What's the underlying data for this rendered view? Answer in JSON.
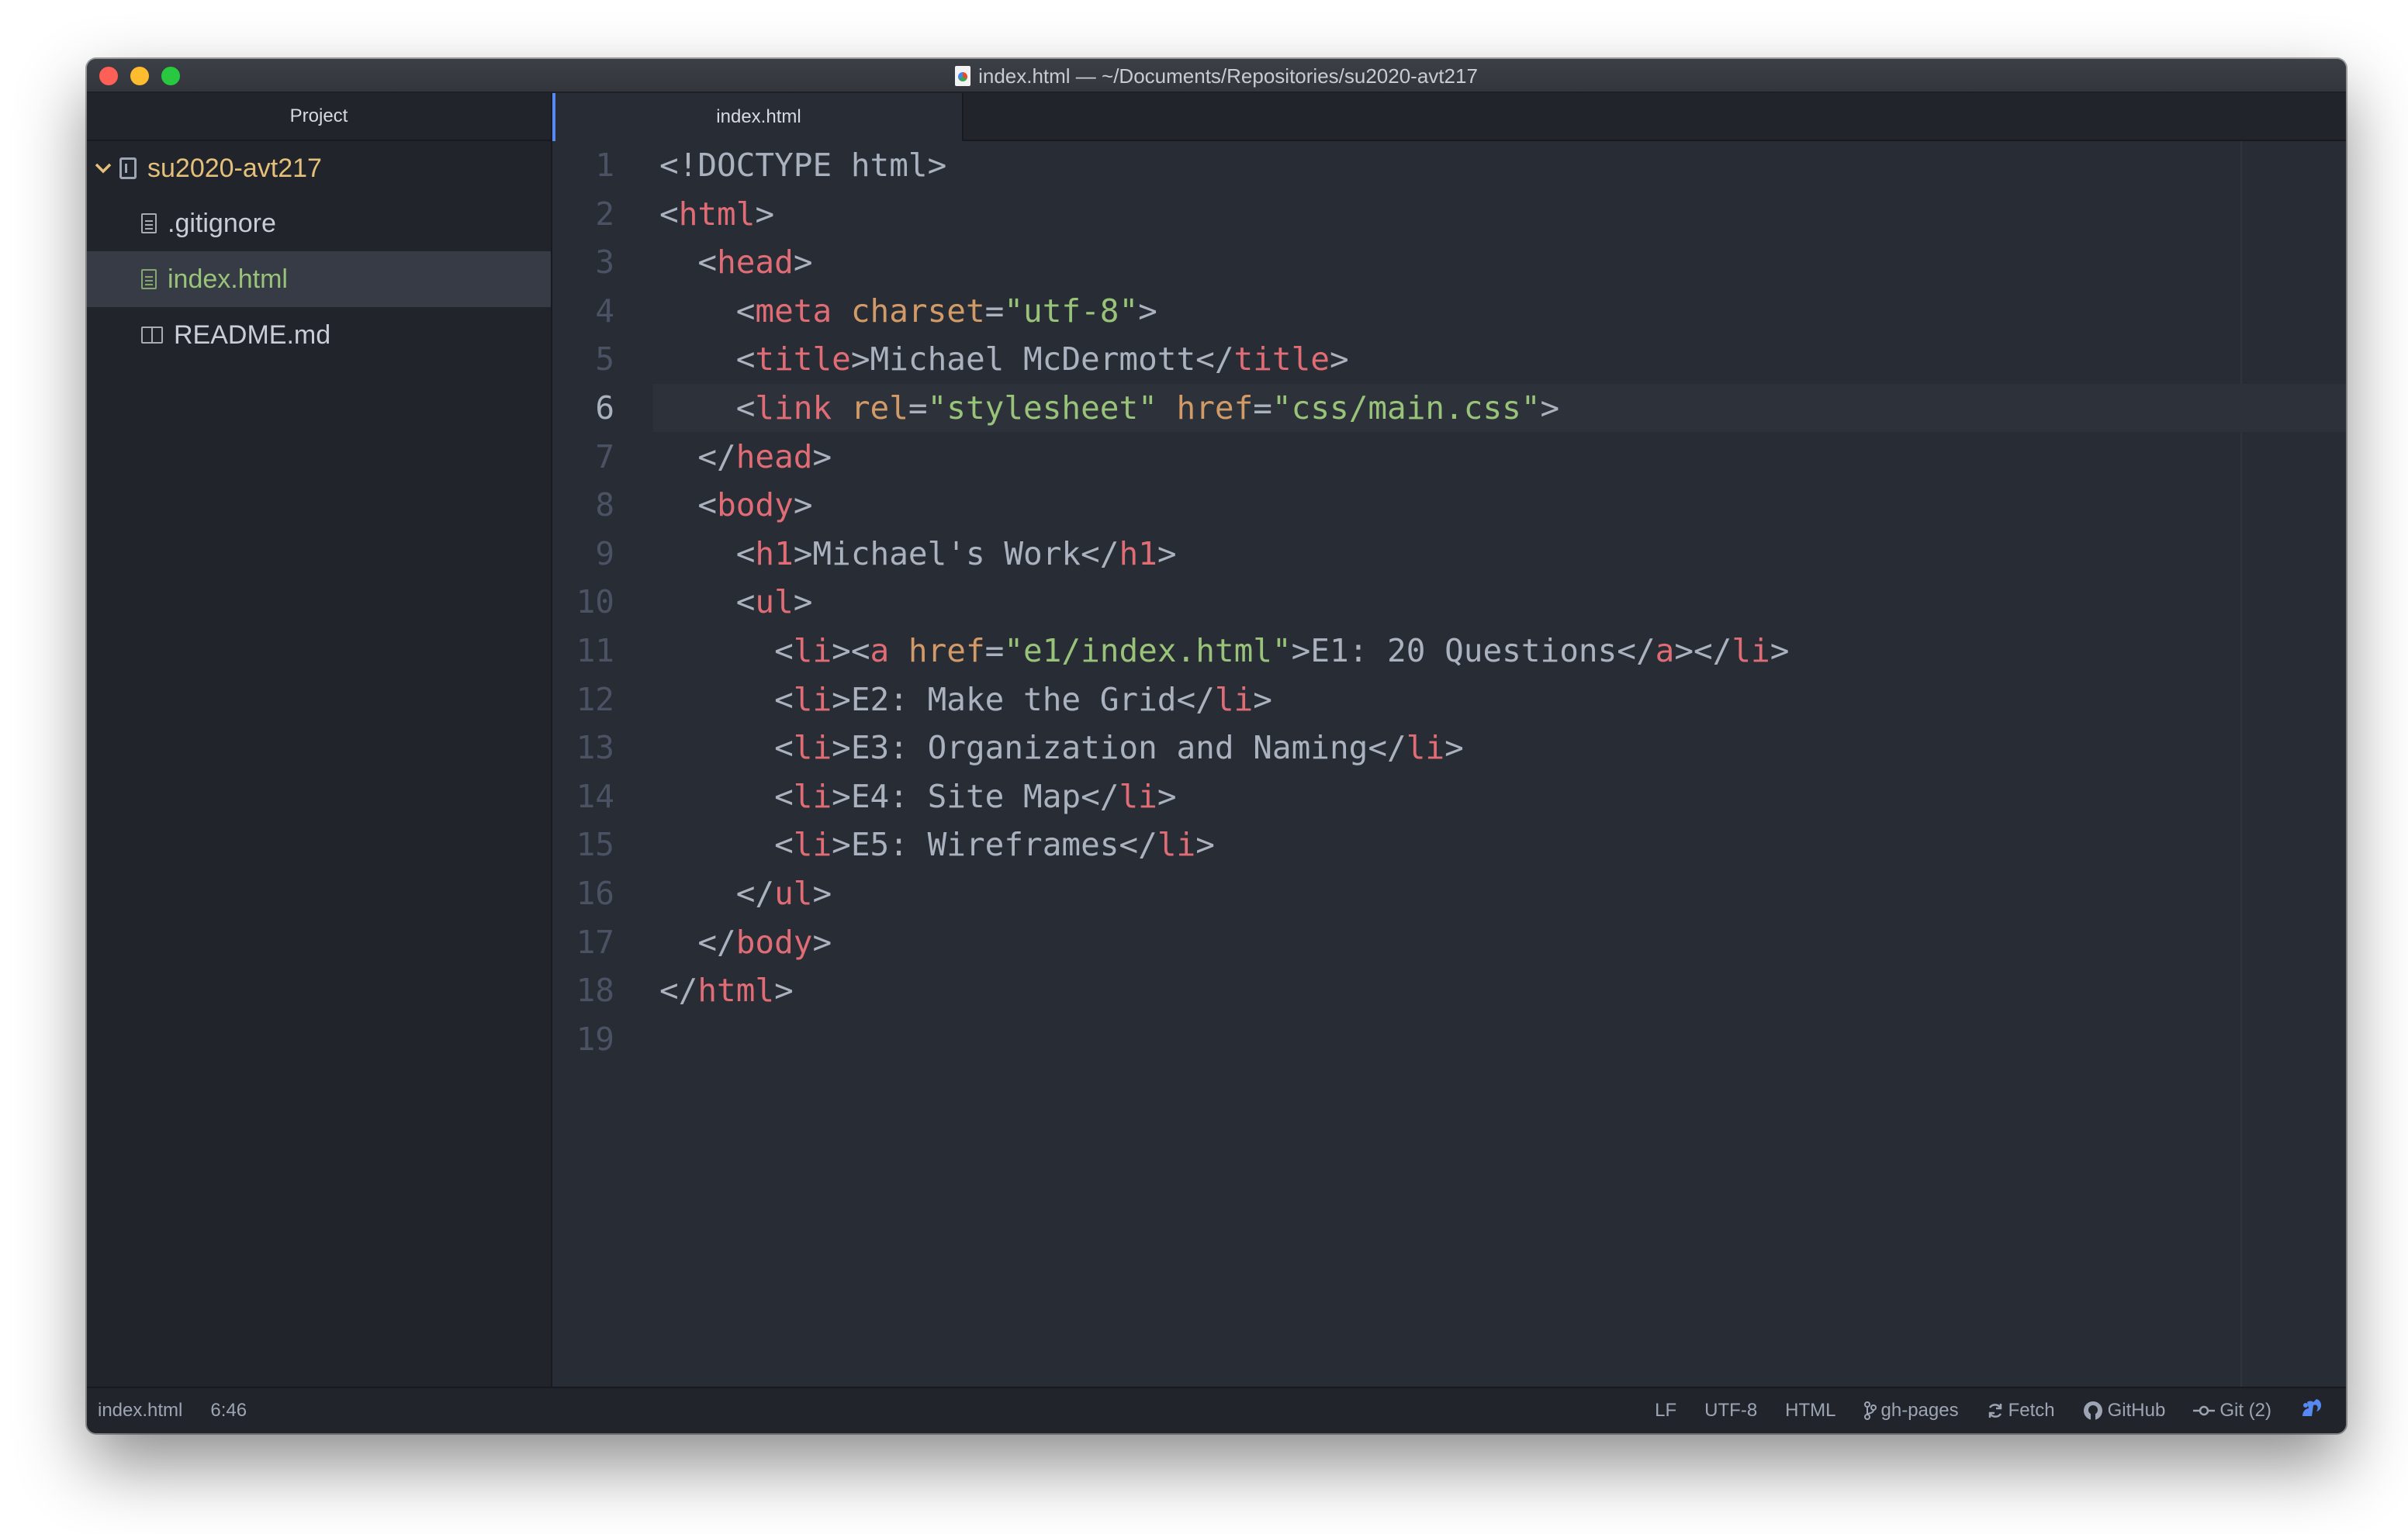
{
  "window": {
    "title": "index.html — ~/Documents/Repositories/su2020-avt217"
  },
  "sidebar": {
    "header": "Project",
    "root": "su2020-avt217",
    "items": [
      {
        "label": ".gitignore",
        "icon": "file-icon"
      },
      {
        "label": "index.html",
        "icon": "file-icon",
        "selected": true
      },
      {
        "label": "README.md",
        "icon": "book-icon"
      }
    ]
  },
  "tabs": [
    {
      "label": "index.html",
      "active": true
    }
  ],
  "editor": {
    "current_line": 6,
    "lines": [
      {
        "n": "1",
        "text": "<!DOCTYPE html>"
      },
      {
        "n": "2",
        "text": "<html>"
      },
      {
        "n": "3",
        "text": "  <head>"
      },
      {
        "n": "4",
        "text": "    <meta charset=\"utf-8\">"
      },
      {
        "n": "5",
        "text": "    <title>Michael McDermott</title>"
      },
      {
        "n": "6",
        "text": "    <link rel=\"stylesheet\" href=\"css/main.css\">"
      },
      {
        "n": "7",
        "text": "  </head>"
      },
      {
        "n": "8",
        "text": "  <body>"
      },
      {
        "n": "9",
        "text": "    <h1>Michael's Work</h1>"
      },
      {
        "n": "10",
        "text": "    <ul>"
      },
      {
        "n": "11",
        "text": "      <li><a href=\"e1/index.html\">E1: 20 Questions</a></li>"
      },
      {
        "n": "12",
        "text": "      <li>E2: Make the Grid</li>"
      },
      {
        "n": "13",
        "text": "      <li>E3: Organization and Naming</li>"
      },
      {
        "n": "14",
        "text": "      <li>E4: Site Map</li>"
      },
      {
        "n": "15",
        "text": "      <li>E5: Wireframes</li>"
      },
      {
        "n": "16",
        "text": "    </ul>"
      },
      {
        "n": "17",
        "text": "  </body>"
      },
      {
        "n": "18",
        "text": "</html>"
      },
      {
        "n": "19",
        "text": ""
      }
    ]
  },
  "statusbar": {
    "file": "index.html",
    "cursor": "6:46",
    "line_ending": "LF",
    "encoding": "UTF-8",
    "grammar": "HTML",
    "branch": "gh-pages",
    "fetch": "Fetch",
    "github": "GitHub",
    "git": "Git (2)"
  },
  "colors": {
    "background": "#282c34",
    "sidebar": "#21252b",
    "tag": "#e06c75",
    "attribute": "#d19a66",
    "string": "#98c379",
    "text": "#abb2bf",
    "folder": "#e5c07b",
    "accent": "#568af2"
  }
}
